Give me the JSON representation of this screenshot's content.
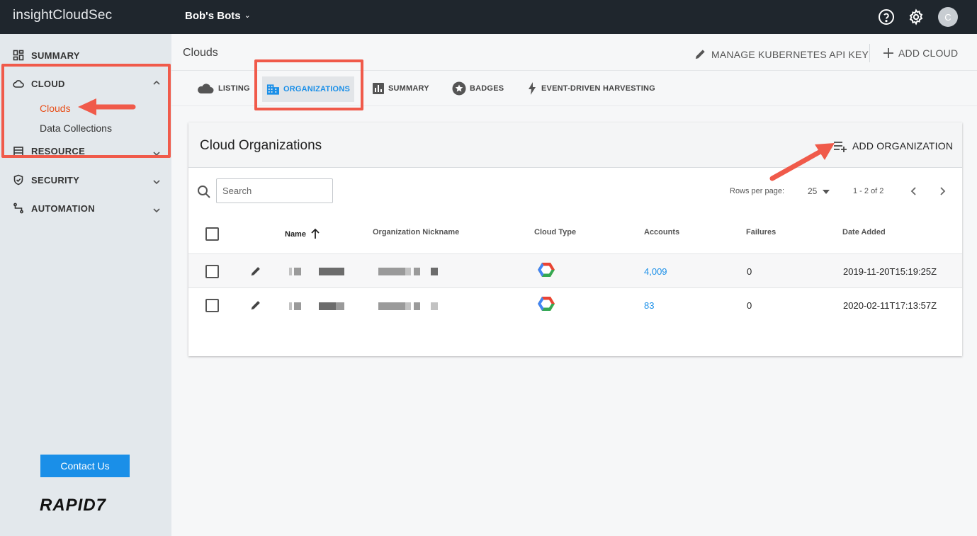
{
  "topbar": {
    "brand": "insightCloudSec",
    "org_name": "Bob's Bots",
    "avatar_initial": "C",
    "icons": [
      "help-icon",
      "gear-icon"
    ]
  },
  "sidebar": {
    "sections": [
      {
        "label": "SUMMARY",
        "icon": "grid-icon"
      },
      {
        "label": "CLOUD",
        "icon": "cloud-icon",
        "expanded": true,
        "items": [
          "Clouds",
          "Data Collections"
        ]
      },
      {
        "label": "RESOURCE",
        "icon": "resource-icon"
      },
      {
        "label": "SECURITY",
        "icon": "shield-icon"
      },
      {
        "label": "AUTOMATION",
        "icon": "automation-icon"
      }
    ],
    "contact_label": "Contact Us",
    "logo_text": "RAPID7"
  },
  "header": {
    "breadcrumb": "Clouds",
    "manage_k8s_label": "MANAGE KUBERNETES API KEY",
    "add_cloud_label": "ADD CLOUD"
  },
  "tabs": [
    {
      "label": "LISTING",
      "icon": "cloud-icon"
    },
    {
      "label": "ORGANIZATIONS",
      "icon": "building-icon",
      "active": true
    },
    {
      "label": "SUMMARY",
      "icon": "chart-icon"
    },
    {
      "label": "BADGES",
      "icon": "star-badge-icon"
    },
    {
      "label": "EVENT-DRIVEN HARVESTING",
      "icon": "bolt-icon"
    }
  ],
  "card": {
    "title": "Cloud Organizations",
    "add_org_label": "ADD ORGANIZATION",
    "search_placeholder": "Search",
    "rows_per_page_label": "Rows per page:",
    "rows_per_page_value": "25",
    "page_info": "1 - 2 of 2",
    "columns": [
      "Name",
      "Organization Nickname",
      "Cloud Type",
      "Accounts",
      "Failures",
      "Date Added"
    ],
    "rows": [
      {
        "cloud_type": "gcp-icon",
        "accounts": "4,009",
        "failures": "0",
        "date_added": "2019-11-20T15:19:25Z"
      },
      {
        "cloud_type": "gcp-icon",
        "accounts": "83",
        "failures": "0",
        "date_added": "2020-02-11T17:13:57Z"
      }
    ]
  },
  "colors": {
    "topbar_bg": "#1f262d",
    "sidebar_bg": "#e3e8ec",
    "accent_blue": "#1a8fe8",
    "active_orange": "#e8501b",
    "annotation_red": "#f05a4a"
  }
}
